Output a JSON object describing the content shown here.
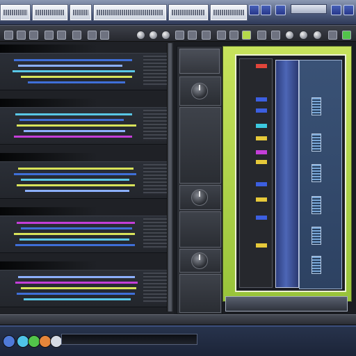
{
  "title_bar": {
    "tabs": [
      {
        "name": "tab-1",
        "label": ""
      },
      {
        "name": "tab-2",
        "label": ""
      },
      {
        "name": "tab-3",
        "label": ""
      },
      {
        "name": "tab-4",
        "label": ""
      },
      {
        "name": "tab-5",
        "label": ""
      },
      {
        "name": "tab-6",
        "label": ""
      }
    ],
    "window_buttons": [
      "minimize-icon",
      "maximize-icon",
      "close-icon"
    ]
  },
  "toolbar": {
    "icons": [
      "record-icon",
      "play-icon",
      "stop-icon",
      "pattern-icon",
      "mixer-icon",
      "browser-icon",
      "settings-icon"
    ]
  },
  "status_bar": {
    "time": ""
  },
  "colors": {
    "accent_green": "#b5d94a",
    "accent_blue": "#3d5bb8",
    "clip_colors": [
      "#3f6fd8",
      "#d8e35a",
      "#59c7e6",
      "#c43ed8",
      "#8cb0ff"
    ],
    "mixer_leds": [
      "#e0453a",
      "#3c5fe0",
      "#e6c93a",
      "#3cc9e0"
    ]
  }
}
